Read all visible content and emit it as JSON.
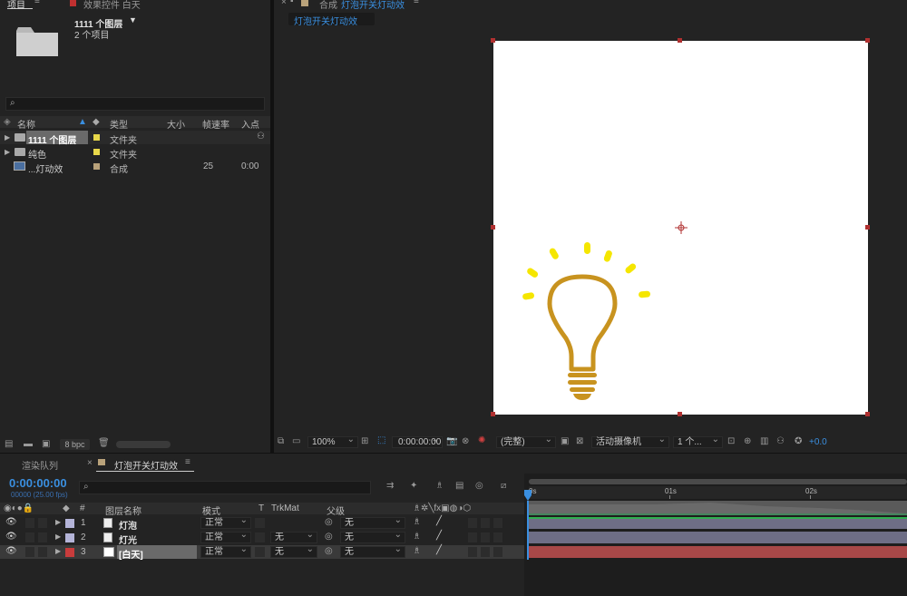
{
  "project_panel": {
    "tab_project": "项目",
    "tab_effects": "效果控件 白天",
    "selected_name": "1111 个图层",
    "selected_count": "2 个项目",
    "search_placeholder": "",
    "columns": {
      "name": "名称",
      "type": "类型",
      "size": "大小",
      "fps": "帧速率",
      "in_point": "入点"
    },
    "items": [
      {
        "name": "1111 个图层",
        "type": "文件夹",
        "fps": "",
        "in": "",
        "color": "#e8d84a",
        "kind": "folder"
      },
      {
        "name": "纯色",
        "type": "文件夹",
        "fps": "",
        "in": "",
        "color": "#e8d84a",
        "kind": "folder"
      },
      {
        "name": "...灯动效",
        "type": "合成",
        "fps": "25",
        "in": "0:00",
        "color": "#b9a27a",
        "kind": "comp"
      }
    ],
    "bpc": "8 bpc"
  },
  "composition_panel": {
    "tab_label": "合成",
    "comp_name": "灯泡开关灯动效",
    "sub_tab": "灯泡开关灯动效",
    "zoom": "100%",
    "timecode": "0:00:00:00",
    "resolution": "(完整)",
    "camera": "活动摄像机",
    "views": "1 个...",
    "exposure": "+0.0",
    "bulb_color": "#c8931f",
    "ray_color": "#f5e600"
  },
  "timeline_panel": {
    "tab_render": "渲染队列",
    "tab_comp": "灯泡开关灯动效",
    "timecode": "0:00:00:00",
    "frame_info": "00000 (25.00 fps)",
    "columns": {
      "num": "#",
      "layer_name": "图层名称",
      "mode": "模式",
      "t": "T",
      "trkmat": "TrkMat",
      "parent": "父级"
    },
    "ruler": [
      "0s",
      "01s",
      "02s"
    ],
    "layers": [
      {
        "num": "1",
        "name": "灯泡",
        "mode": "正常",
        "trkmat": "",
        "parent": "无",
        "label_color": "#b4b4d8",
        "bar_color": "#6e6e86"
      },
      {
        "num": "2",
        "name": "灯光",
        "mode": "正常",
        "trkmat": "无",
        "parent": "无",
        "label_color": "#b4b4d8",
        "bar_color": "#6e6e86"
      },
      {
        "num": "3",
        "name": "[白天]",
        "mode": "正常",
        "trkmat": "无",
        "parent": "无",
        "label_color": "#c83c3c",
        "bar_color": "#a84848"
      }
    ]
  }
}
